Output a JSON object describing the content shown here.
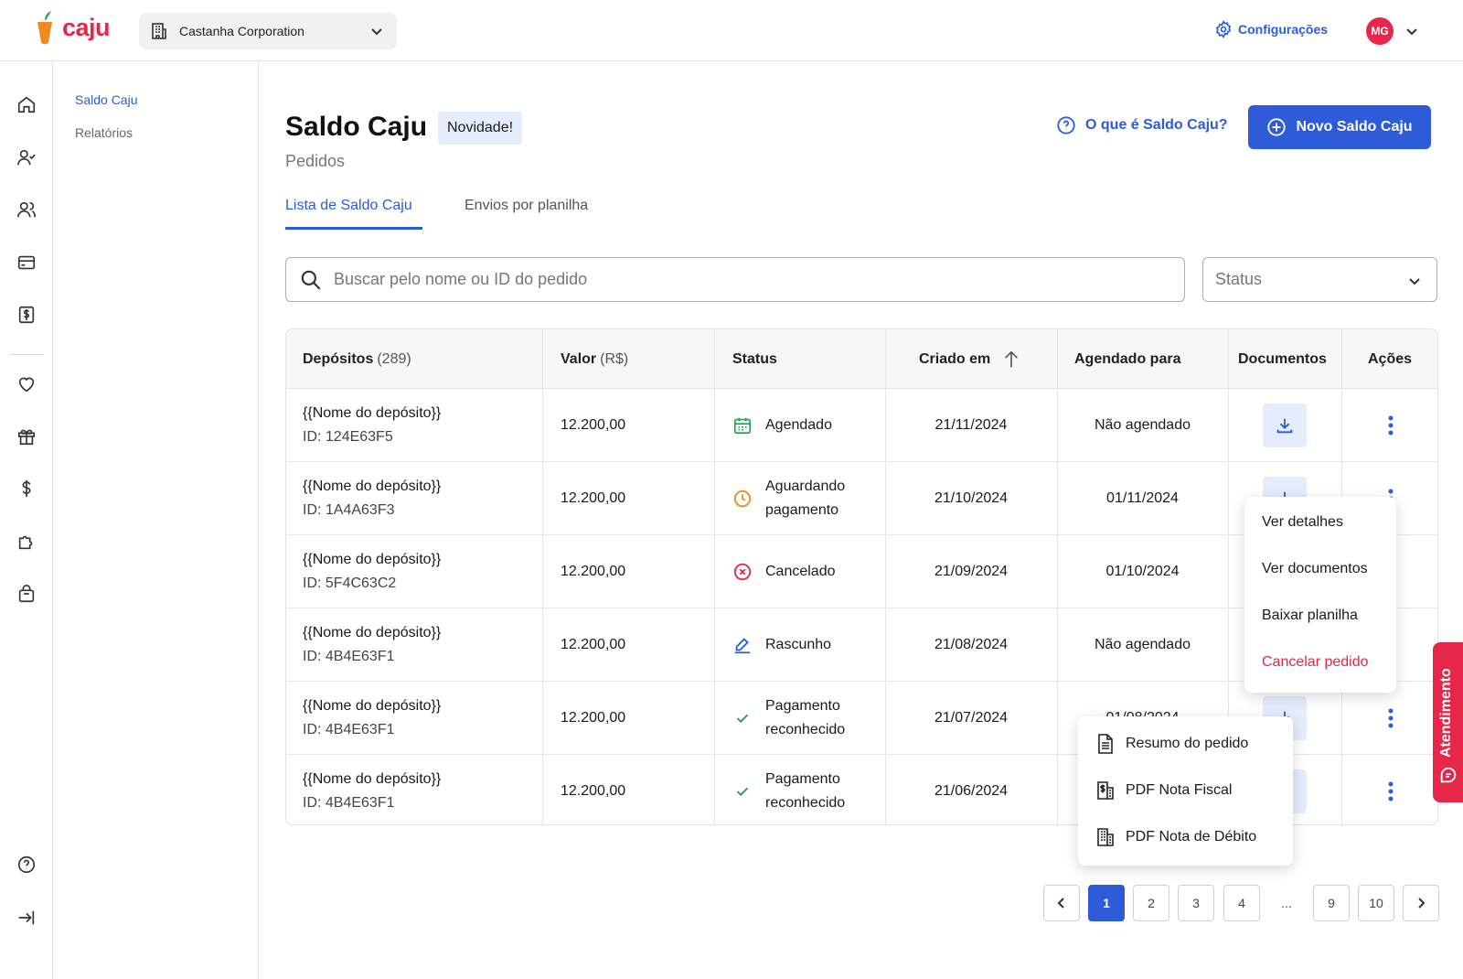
{
  "header": {
    "logo_text": "caju",
    "company": "Castanha Corporation",
    "settings_label": "Configurações",
    "avatar_initials": "MG"
  },
  "submenu": {
    "active": "Saldo Caju",
    "reports": "Relatórios"
  },
  "page": {
    "title": "Saldo Caju",
    "badge": "Novidade!",
    "subtitle": "Pedidos",
    "help_link": "O que é Saldo Caju?",
    "new_button": "Novo Saldo Caju"
  },
  "tabs": [
    "Lista de Saldo Caju",
    "Envios por planilha"
  ],
  "search": {
    "placeholder": "Buscar pelo nome ou ID do pedido"
  },
  "status_filter": {
    "placeholder": "Status"
  },
  "table": {
    "headers": {
      "deposits": "Depósitos",
      "deposits_count": "(289)",
      "value": "Valor",
      "value_unit": "(R$)",
      "status": "Status",
      "created": "Criado em",
      "scheduled": "Agendado para",
      "documents": "Documentos",
      "actions": "Ações"
    },
    "rows": [
      {
        "name": "{{Nome do depósito}}",
        "id": "ID: 124E63F5",
        "value": "12.200,00",
        "status_l1": "Agendado",
        "status_l2": "",
        "status_icon": "calendar-check-icon",
        "created": "21/11/2024",
        "scheduled": "Não agendado"
      },
      {
        "name": "{{Nome do depósito}}",
        "id": "ID: 1A4A63F3",
        "value": "12.200,00",
        "status_l1": "Aguardando",
        "status_l2": "pagamento",
        "status_icon": "clock-icon",
        "created": "21/10/2024",
        "scheduled": "01/11/2024"
      },
      {
        "name": "{{Nome do depósito}}",
        "id": "ID: 5F4C63C2",
        "value": "12.200,00",
        "status_l1": "Cancelado",
        "status_l2": "",
        "status_icon": "cancel-icon",
        "created": "21/09/2024",
        "scheduled": "01/10/2024"
      },
      {
        "name": "{{Nome do depósito}}",
        "id": "ID: 4B4E63F1",
        "value": "12.200,00",
        "status_l1": "Rascunho",
        "status_l2": "",
        "status_icon": "pencil-icon",
        "created": "21/08/2024",
        "scheduled": "Não agendado"
      },
      {
        "name": "{{Nome do depósito}}",
        "id": "ID: 4B4E63F1",
        "value": "12.200,00",
        "status_l1": "Pagamento",
        "status_l2": "reconhecido",
        "status_icon": "check-icon",
        "created": "21/07/2024",
        "scheduled": "01/08/2024"
      },
      {
        "name": "{{Nome do depósito}}",
        "id": "ID: 4B4E63F1",
        "value": "12.200,00",
        "status_l1": "Pagamento",
        "status_l2": "reconhecido",
        "status_icon": "check-icon",
        "created": "21/06/2024",
        "scheduled": ""
      }
    ]
  },
  "actions_menu": [
    "Ver detalhes",
    "Ver documentos",
    "Baixar planilha",
    "Cancelar pedido"
  ],
  "documents_menu": [
    "Resumo do pedido",
    "PDF Nota Fiscal",
    "PDF Nota de Débito"
  ],
  "pagination": [
    "1",
    "2",
    "3",
    "4",
    "...",
    "9",
    "10"
  ],
  "support": {
    "label": "Atendimento"
  },
  "colors": {
    "brand": "#e6274a",
    "accent": "#2e5bd8",
    "success": "#1f9d55",
    "warning": "#f08a1c"
  }
}
